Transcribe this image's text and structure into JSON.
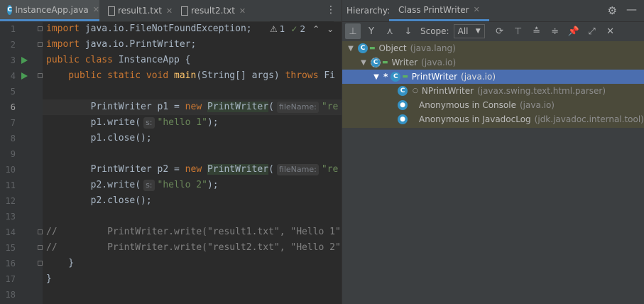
{
  "editor": {
    "tabs": [
      {
        "label": "InstanceApp.java",
        "icon": "java-class-icon",
        "active": true
      },
      {
        "label": "result1.txt",
        "icon": "text-file-icon",
        "active": false
      },
      {
        "label": "result2.txt",
        "icon": "text-file-icon",
        "active": false
      }
    ],
    "inspections": {
      "warnings": "1",
      "ok": "2"
    },
    "line_numbers": [
      "1",
      "2",
      "3",
      "4",
      "5",
      "6",
      "7",
      "8",
      "9",
      "10",
      "11",
      "12",
      "13",
      "14",
      "15",
      "16",
      "17",
      "18"
    ],
    "current_line": 6,
    "code": {
      "l1_kw": "import",
      "l1_rest": " java.io.FileNotFoundException;",
      "l2_kw": "import",
      "l2_rest": " java.io.PrintWriter;",
      "l3_kw": "public class",
      "l3_rest": " InstanceApp {",
      "l4_kw1": "    public static void",
      "l4_fn": " main",
      "l4_mid": "(String[] args) ",
      "l4_kw2": "throws",
      "l4_rest": " Fi",
      "l6_a": "        PrintWriter p1 = ",
      "l6_kw": "new",
      "l6_sp": " ",
      "l6_hl": "PrintWriter",
      "l6_b": "(",
      "l6_hint": "fileName:",
      "l6_str": "\"re",
      "l7_a": "        p1.write(",
      "l7_hint": "s:",
      "l7_str": "\"hello 1\"",
      "l7_b": ");",
      "l8": "        p1.close();",
      "l10_a": "        PrintWriter p2 = ",
      "l10_kw": "new",
      "l10_sp": " ",
      "l10_hl": "PrintWriter",
      "l10_b": "(",
      "l10_hint": "fileName:",
      "l10_str": "\"re",
      "l11_a": "        p2.write(",
      "l11_hint": "s:",
      "l11_str": "\"hello 2\"",
      "l11_b": ");",
      "l12": "        p2.close();",
      "l14": "//         PrintWriter.write(\"result1.txt\", \"Hello 1\"",
      "l15": "//         PrintWriter.write(\"result2.txt\", \"Hello 2\"",
      "l16": "    }",
      "l17": "}"
    }
  },
  "hierarchy": {
    "label": "Hierarchy:",
    "tab": "Class PrintWriter",
    "scope_label": "Scope:",
    "scope_value": "All",
    "tree": [
      {
        "name": "Object",
        "pkg": "(java.lang)",
        "icon": "C",
        "level": 0,
        "expanded": true
      },
      {
        "name": "Writer",
        "pkg": "(java.io)",
        "icon": "C",
        "level": 1,
        "expanded": true,
        "abstract": true
      },
      {
        "name": "PrintWriter",
        "pkg": "(java.io)",
        "icon": "C",
        "level": 2,
        "expanded": true,
        "selected": true,
        "marker": "*"
      },
      {
        "name": "NPrintWriter",
        "pkg": "(javax.swing.text.html.parser)",
        "icon": "C",
        "level": 3
      },
      {
        "name": "Anonymous in Console",
        "pkg": "(java.io)",
        "icon": "anon",
        "level": 3
      },
      {
        "name": "Anonymous in JavadocLog",
        "pkg": "(jdk.javadoc.internal.tool)",
        "icon": "anon",
        "level": 3
      }
    ]
  },
  "colors": {
    "accent": "#4a88c7",
    "selection": "#4b6eaf",
    "keyword": "#cc7832",
    "string": "#6a8759",
    "function": "#ffc66d"
  }
}
